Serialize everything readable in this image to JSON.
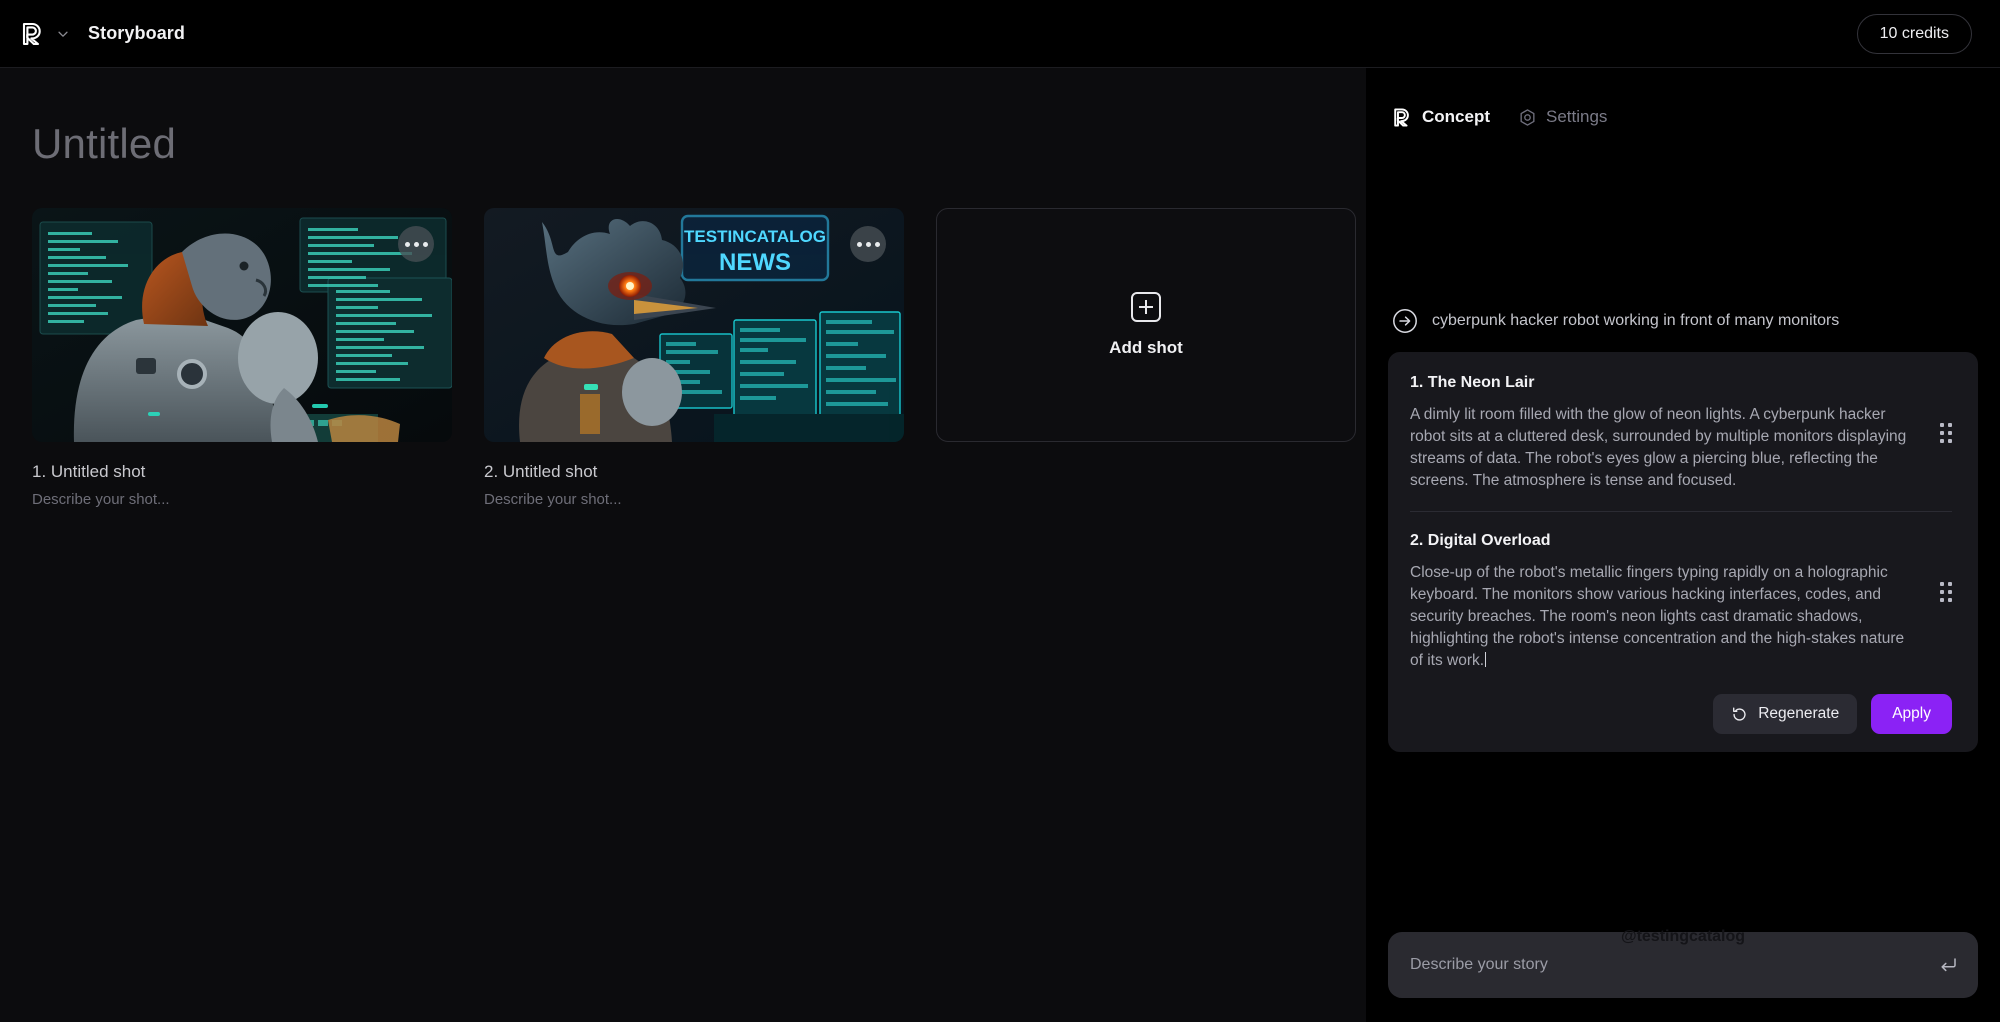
{
  "topbar": {
    "logo_icon": "app-logo-icon",
    "dropdown_icon": "chevron-down-icon",
    "title": "Storyboard",
    "credits_label": "10 credits"
  },
  "canvas": {
    "doc_title": "Untitled",
    "shots": [
      {
        "name": "1. Untitled shot",
        "description": "Describe your shot...",
        "menu_icon": "more-options-icon",
        "image_alt": "cyberpunk hooded robot at desk with code monitors"
      },
      {
        "name": "2. Untitled shot",
        "description": "Describe your shot...",
        "menu_icon": "more-options-icon",
        "image_alt": "cyborg bird with red glowing eye and TESTINCATALOG NEWS neon sign"
      }
    ],
    "add_shot": {
      "label": "Add shot",
      "icon": "plus-square-icon"
    },
    "thumb2_sign_line1": "TESTINCATALOG",
    "thumb2_sign_line2": "NEWS"
  },
  "panel": {
    "tabs": [
      {
        "label": "Concept",
        "icon": "app-logo-icon",
        "active": true
      },
      {
        "label": "Settings",
        "icon": "gear-hex-icon",
        "active": false
      }
    ],
    "prompt": {
      "icon": "arrow-right-circle-icon",
      "text": "cyberpunk hacker robot working in front of many monitors"
    },
    "scenes": [
      {
        "title": "1. The Neon Lair",
        "body": "A dimly lit room filled with the glow of neon lights. A cyberpunk hacker robot sits at a cluttered desk, surrounded by multiple monitors displaying streams of data. The robot's eyes glow a piercing blue, reflecting the screens. The atmosphere is tense and focused.",
        "grip_icon": "drag-handle-icon"
      },
      {
        "title": "2. Digital Overload",
        "body": "Close-up of the robot's metallic fingers typing rapidly on a holographic keyboard. The monitors show various hacking interfaces, codes, and security breaches. The room's neon lights cast dramatic shadows, highlighting the robot's intense concentration and the high-stakes nature of its work.",
        "grip_icon": "drag-handle-icon"
      }
    ],
    "actions": {
      "regenerate_label": "Regenerate",
      "regenerate_icon": "refresh-ccw-icon",
      "apply_label": "Apply"
    },
    "composer": {
      "placeholder": "Describe your story",
      "value": "",
      "submit_icon": "enter-return-icon"
    },
    "watermark": "@testingcatalog"
  },
  "colors": {
    "accent": "#8b22f5",
    "panel_bg": "#000000",
    "canvas_bg": "#0c0c0e",
    "card_bg": "#18181d",
    "composer_bg": "#2a2a30"
  }
}
